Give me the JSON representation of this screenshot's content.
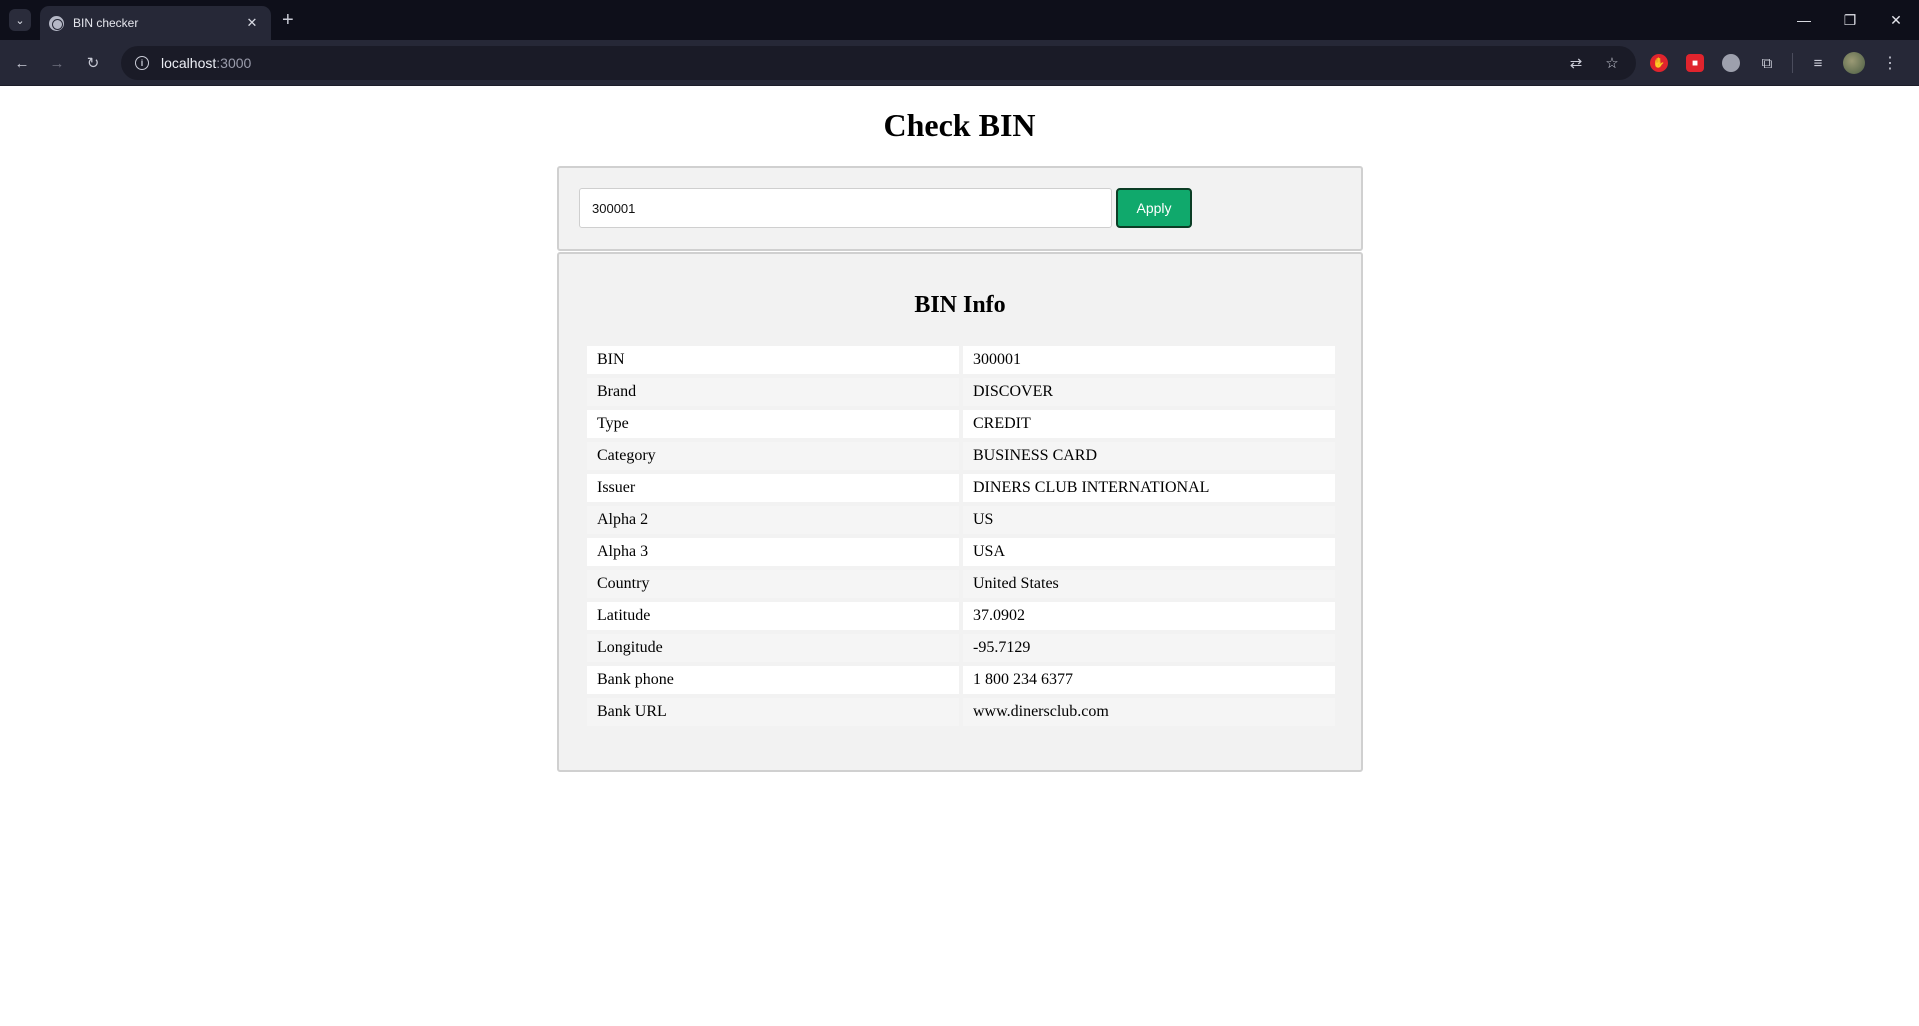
{
  "browser": {
    "tab_title": "BIN checker",
    "url_host": "localhost",
    "url_port": ":3000"
  },
  "page": {
    "title": "Check BIN",
    "input_value": "300001",
    "apply_label": "Apply",
    "info_title": "BIN Info",
    "rows": [
      {
        "label": "BIN",
        "value": "300001"
      },
      {
        "label": "Brand",
        "value": "DISCOVER"
      },
      {
        "label": "Type",
        "value": "CREDIT"
      },
      {
        "label": "Category",
        "value": "BUSINESS CARD"
      },
      {
        "label": "Issuer",
        "value": "DINERS CLUB INTERNATIONAL"
      },
      {
        "label": "Alpha 2",
        "value": "US"
      },
      {
        "label": "Alpha 3",
        "value": "USA"
      },
      {
        "label": "Country",
        "value": "United States"
      },
      {
        "label": "Latitude",
        "value": "37.0902"
      },
      {
        "label": "Longitude",
        "value": "-95.7129"
      },
      {
        "label": "Bank phone",
        "value": "1 800 234 6377"
      },
      {
        "label": "Bank URL",
        "value": "www.dinersclub.com"
      }
    ]
  },
  "colors": {
    "apply_button": "#10a96c",
    "panel_background": "#f2f2f2",
    "chrome_background": "#262837"
  }
}
